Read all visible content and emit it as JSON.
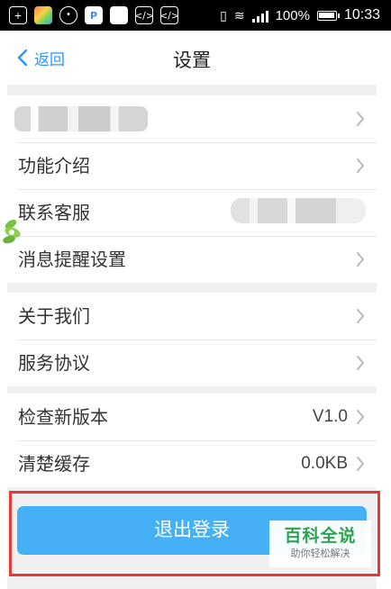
{
  "status_bar": {
    "battery_percent": "100%",
    "time": "10:33"
  },
  "header": {
    "back_label": "返回",
    "title": "设置"
  },
  "settings_groups": [
    {
      "rows": [
        {
          "label": "",
          "value": ""
        },
        {
          "label": "功能介绍",
          "value": ""
        },
        {
          "label": "联系客服",
          "value": ""
        },
        {
          "label": "消息提醒设置",
          "value": ""
        }
      ]
    },
    {
      "rows": [
        {
          "label": "关于我们",
          "value": ""
        },
        {
          "label": "服务协议",
          "value": ""
        }
      ]
    },
    {
      "rows": [
        {
          "label": "检查新版本",
          "value": "V1.0"
        },
        {
          "label": "清楚缓存",
          "value": "0.0KB"
        }
      ]
    }
  ],
  "logout_button": {
    "label": "退出登录"
  },
  "watermark": {
    "main": "百科全说",
    "sub": "助你轻松解决"
  },
  "colors": {
    "accent": "#2f93ff",
    "button": "#45b0f5",
    "highlight": "#e53935",
    "watermark_green": "#2ea44f"
  },
  "icons": {
    "back": "chevron-left-icon",
    "row_arrow": "chevron-right-icon"
  }
}
